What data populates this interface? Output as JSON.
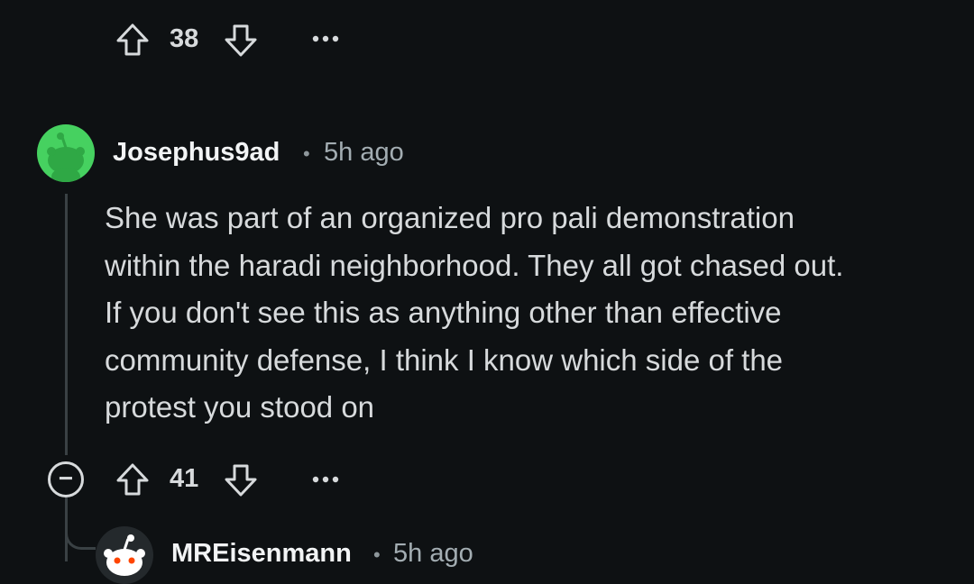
{
  "top_actions": {
    "vote_count": "38"
  },
  "comment": {
    "username": "Josephus9ad",
    "separator": "•",
    "time": "5h ago",
    "lines": [
      "She was part of an organized pro pali demonstration",
      "within the haradi neighborhood. They all got chased out.",
      "If you don't see this as anything other than effective",
      "community defense, I think I know which side of the",
      "protest you stood on"
    ],
    "vote_count": "41",
    "collapse_glyph": "−"
  },
  "reply": {
    "username": "MREisenmann",
    "separator": "•",
    "time": "5h ago"
  },
  "colors": {
    "background": "#0e1113",
    "avatar_green": "#46d160",
    "text": "#d7dadc",
    "meta": "#a3adb2",
    "thread_line": "#3a4144"
  },
  "icons": [
    "upvote-icon",
    "downvote-icon",
    "more-options-icon",
    "collapse-icon",
    "avatar-icon"
  ]
}
